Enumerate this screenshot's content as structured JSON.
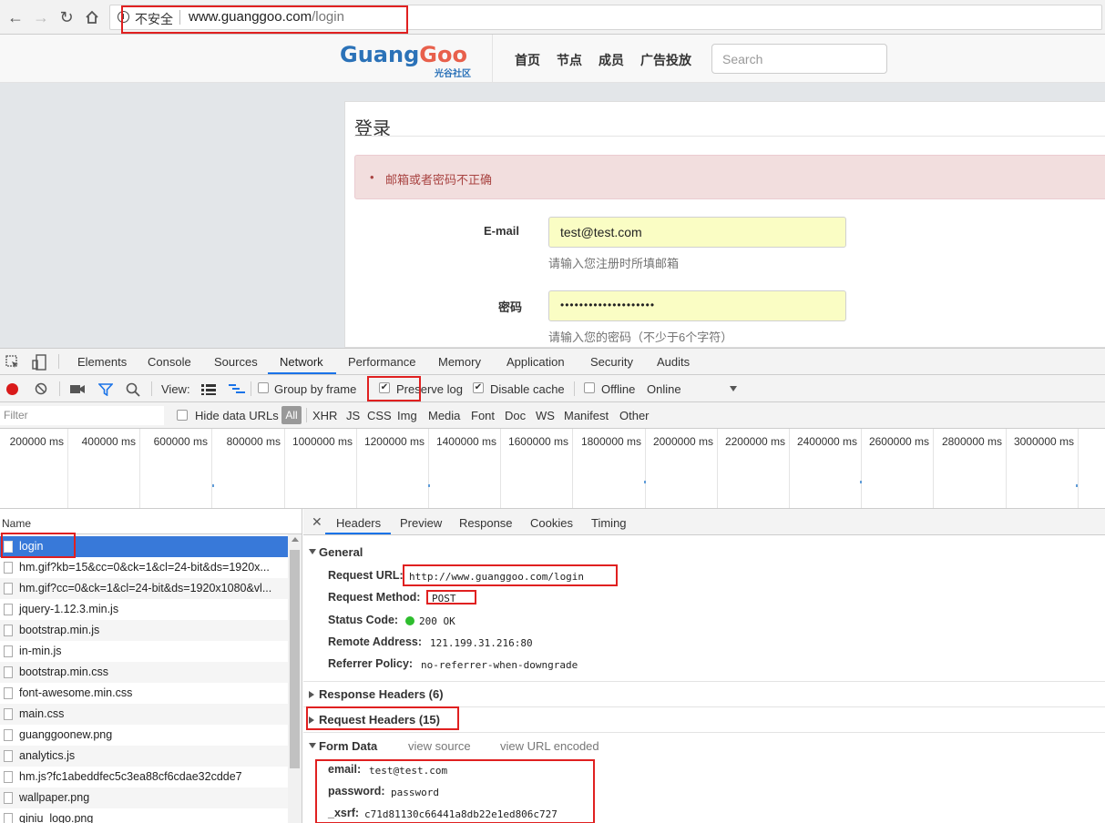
{
  "browser": {
    "security_label": "不安全",
    "url_host": "www.guanggoo.com",
    "url_path": "/login"
  },
  "site": {
    "logo_main_a": "Guang",
    "logo_main_b": "Goo",
    "logo_sub": "光谷社区",
    "nav": [
      "首页",
      "节点",
      "成员",
      "广告投放"
    ],
    "search_placeholder": "Search"
  },
  "login": {
    "title": "登录",
    "error_message": "邮箱或者密码不正确",
    "email_label": "E-mail",
    "email_value": "test@test.com",
    "email_help": "请输入您注册时所填邮箱",
    "password_label": "密码",
    "password_value": "••••••••••••••••••••",
    "password_help": "请输入您的密码（不少于6个字符）"
  },
  "devtools": {
    "tabs": [
      "Elements",
      "Console",
      "Sources",
      "Network",
      "Performance",
      "Memory",
      "Application",
      "Security",
      "Audits"
    ],
    "active_tab": "Network",
    "toolbar": {
      "view_label": "View:",
      "group_by_frame": "Group by frame",
      "preserve_log": "Preserve log",
      "disable_cache": "Disable cache",
      "offline": "Offline",
      "throttling": "Online"
    },
    "filter": {
      "placeholder": "Filter",
      "hide_data_urls": "Hide data URLs",
      "all": "All",
      "types": [
        "XHR",
        "JS",
        "CSS",
        "Img",
        "Media",
        "Font",
        "Doc",
        "WS",
        "Manifest",
        "Other"
      ]
    },
    "timeline_ticks": [
      "200000 ms",
      "400000 ms",
      "600000 ms",
      "800000 ms",
      "1000000 ms",
      "1200000 ms",
      "1400000 ms",
      "1600000 ms",
      "1800000 ms",
      "2000000 ms",
      "2200000 ms",
      "2400000 ms",
      "2600000 ms",
      "2800000 ms",
      "3000000 ms",
      "320"
    ],
    "name_header": "Name",
    "requests": [
      "login",
      "hm.gif?kb=15&cc=0&ck=1&cl=24-bit&ds=1920x...",
      "hm.gif?cc=0&ck=1&cl=24-bit&ds=1920x1080&vl...",
      "jquery-1.12.3.min.js",
      "bootstrap.min.js",
      "in-min.js",
      "bootstrap.min.css",
      "font-awesome.min.css",
      "main.css",
      "guanggoonew.png",
      "analytics.js",
      "hm.js?fc1abeddfec5c3ea88cf6cdae32cdde7",
      "wallpaper.png",
      "qiniu_logo.png"
    ],
    "detail_tabs": [
      "Headers",
      "Preview",
      "Response",
      "Cookies",
      "Timing"
    ],
    "general": {
      "title": "General",
      "request_url_key": "Request URL:",
      "request_url": "http://www.guanggoo.com/login",
      "method_key": "Request Method:",
      "method": "POST",
      "status_key": "Status Code:",
      "status": "200 OK",
      "remote_key": "Remote Address:",
      "remote": "121.199.31.216:80",
      "referrer_key": "Referrer Policy:",
      "referrer": "no-referrer-when-downgrade"
    },
    "response_headers": "Response Headers (6)",
    "request_headers": "Request Headers (15)",
    "form_data": {
      "title": "Form Data",
      "view_source": "view source",
      "view_url_encoded": "view URL encoded",
      "email_key": "email:",
      "email": "test@test.com",
      "password_key": "password:",
      "password": "password",
      "xsrf_key": "_xsrf:",
      "xsrf": "c71d81130c66441a8db22e1ed806c727"
    }
  },
  "colors": {
    "accent": "#1a73e8",
    "selected_row": "#3879d9",
    "highlight_box": "#e02020",
    "autofill": "#fafdc4",
    "alert_bg": "#f2dede"
  }
}
